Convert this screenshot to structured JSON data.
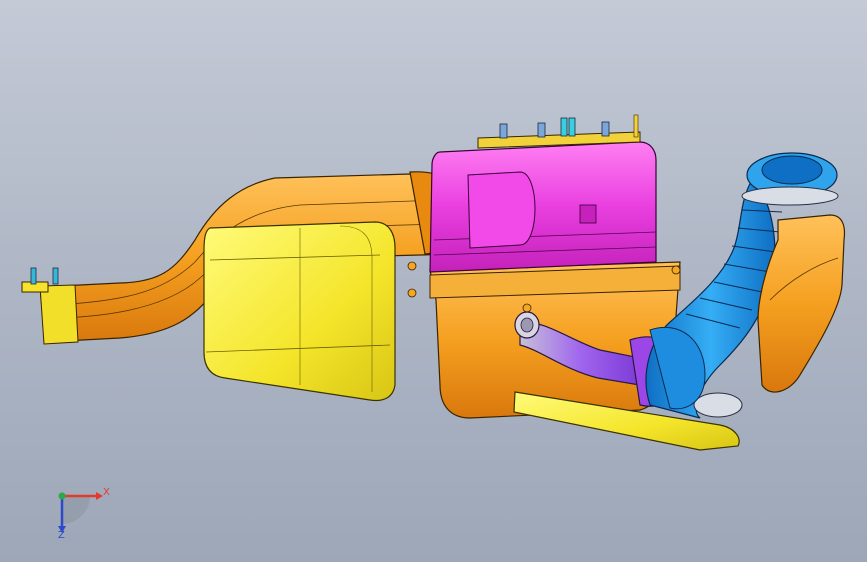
{
  "viewport": {
    "background_top": "#c4cad6",
    "background_bottom": "#9da7b8"
  },
  "model": {
    "parts": [
      {
        "name": "intake-duct",
        "color": "#f5a623"
      },
      {
        "name": "resonator-box",
        "color": "#f7e32d"
      },
      {
        "name": "air-filter-cover",
        "color": "#e93fe0"
      },
      {
        "name": "air-filter-housing",
        "color": "#f5a623"
      },
      {
        "name": "corrugated-hose",
        "color": "#1e8de0"
      },
      {
        "name": "throttle-adapter",
        "color": "#9c46e8"
      },
      {
        "name": "support-bracket",
        "color": "#f7e32d"
      },
      {
        "name": "hose-shield",
        "color": "#f5931d"
      }
    ]
  },
  "triad": {
    "x_label": "X",
    "z_label": "Z",
    "x_color": "#e23b2c",
    "y_color": "#2aa84a",
    "z_color": "#2c49c8"
  }
}
